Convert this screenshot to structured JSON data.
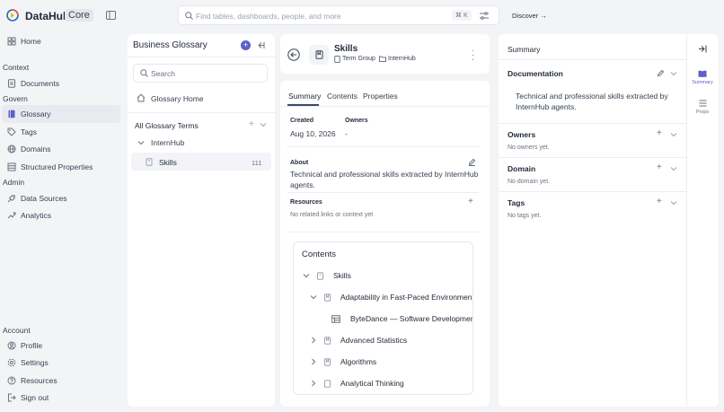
{
  "header": {
    "brand": "DataHub",
    "edition": "Core",
    "search_placeholder": "Find tables, dashboards, people, and more",
    "shortcut": "⌘ K",
    "discover": "Discover →"
  },
  "nav": {
    "home": "Home",
    "context": "Context",
    "documents": "Documents",
    "govern": "Govern",
    "glossary": "Glossary",
    "tags": "Tags",
    "domains": "Domains",
    "structured_properties": "Structured Properties",
    "admin": "Admin",
    "data_sources": "Data Sources",
    "analytics": "Analytics",
    "account": "Account",
    "profile": "Profile",
    "settings": "Settings",
    "resources": "Resources",
    "sign_out": "Sign out"
  },
  "glossary": {
    "title": "Business Glossary",
    "search_placeholder": "Search",
    "home": "Glossary Home",
    "all_terms": "All Glossary Terms",
    "group": "InternHub",
    "term": "Skills",
    "term_count": "111"
  },
  "entity": {
    "name": "Skills",
    "type": "Term Group",
    "parent": "InternHub",
    "tabs": [
      "Summary",
      "Contents",
      "Properties"
    ],
    "created_label": "Created",
    "created_value": "Aug 10, 2026",
    "owners_label": "Owners",
    "owners_value": "-",
    "about_label": "About",
    "about_text_1": "Technical and professional skills extracted by InternHub",
    "about_text_2": "agents.",
    "resources_label": "Resources",
    "resources_empty": "No related links or context yet",
    "contents_title": "Contents",
    "tree": [
      {
        "label": "Skills"
      },
      {
        "label": "Adaptability in Fast-Paced Environment"
      },
      {
        "label": "ByteDance — Software Development"
      },
      {
        "label": "Advanced Statistics"
      },
      {
        "label": "Algorithms"
      },
      {
        "label": "Analytical Thinking"
      }
    ]
  },
  "summary": {
    "title": "Summary",
    "documentation": "Documentation",
    "doc_text_1": "Technical and professional skills extracted by",
    "doc_text_2": "InternHub agents.",
    "owners": "Owners",
    "owners_empty": "No owners yet.",
    "domain": "Domain",
    "domain_empty": "No domain yet.",
    "tags": "Tags",
    "tags_empty": "No tags yet.",
    "rail_summary": "Summary",
    "rail_props": "Props"
  },
  "colors": {
    "accent": "#5b5fc7",
    "active_bg": "#e8eaf0"
  }
}
